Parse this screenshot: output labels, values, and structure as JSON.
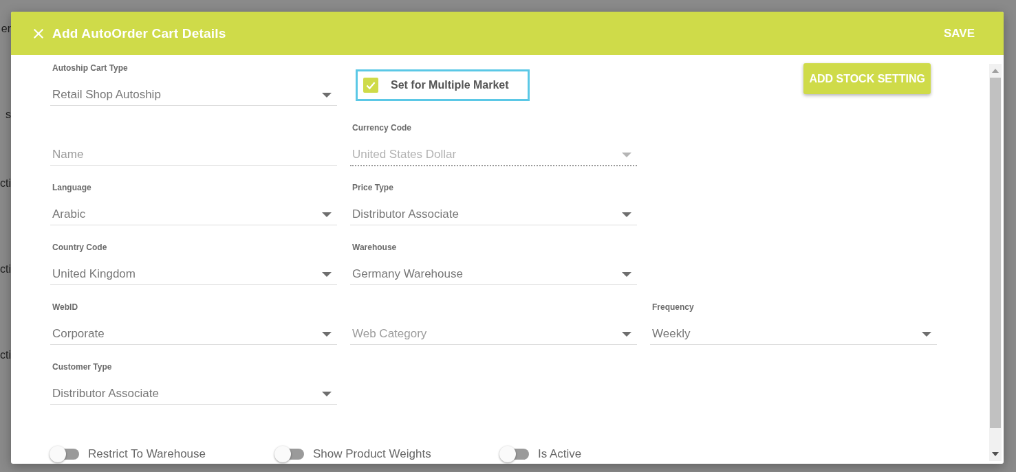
{
  "backdrop": [
    "er",
    "s",
    "cti",
    "cti",
    "cti"
  ],
  "dialog": {
    "title": "Add AutoOrder Cart Details",
    "save": "SAVE"
  },
  "rows": [
    [
      {
        "kind": "select",
        "label": "Autoship Cart Type",
        "value": "Retail Shop Autoship",
        "disabled": false
      },
      {
        "kind": "checkbox",
        "label": "Set for Multiple Market",
        "checked": true,
        "focused": true
      },
      {
        "kind": "button",
        "label": "ADD STOCK SETTING"
      }
    ],
    [
      {
        "kind": "input",
        "placeholder": "Name"
      },
      {
        "kind": "select",
        "label": "Currency Code",
        "value": "United States Dollar",
        "disabled": true
      },
      {
        "kind": "blank"
      }
    ],
    [
      {
        "kind": "select",
        "label": "Language",
        "value": "Arabic",
        "disabled": false
      },
      {
        "kind": "select",
        "label": "Price Type",
        "value": "Distributor Associate",
        "disabled": false
      },
      {
        "kind": "blank"
      }
    ],
    [
      {
        "kind": "select",
        "label": "Country Code",
        "value": "United Kingdom",
        "disabled": false
      },
      {
        "kind": "select",
        "label": "Warehouse",
        "value": "Germany Warehouse",
        "disabled": false
      },
      {
        "kind": "blank"
      }
    ],
    [
      {
        "kind": "select",
        "label": "WebID",
        "value": "Corporate",
        "disabled": false
      },
      {
        "kind": "select",
        "placeholder": "Web Category",
        "disabled": false
      },
      {
        "kind": "select",
        "label": "Frequency",
        "value": "Weekly",
        "disabled": false
      }
    ],
    [
      {
        "kind": "select",
        "label": "Customer Type",
        "value": "Distributor Associate",
        "disabled": false
      },
      {
        "kind": "blank"
      },
      {
        "kind": "blank"
      }
    ]
  ],
  "toggles": [
    {
      "label": "Restrict To Warehouse",
      "on": false
    },
    {
      "label": "Show Product Weights",
      "on": false
    },
    {
      "label": "Is Active",
      "on": false
    }
  ]
}
